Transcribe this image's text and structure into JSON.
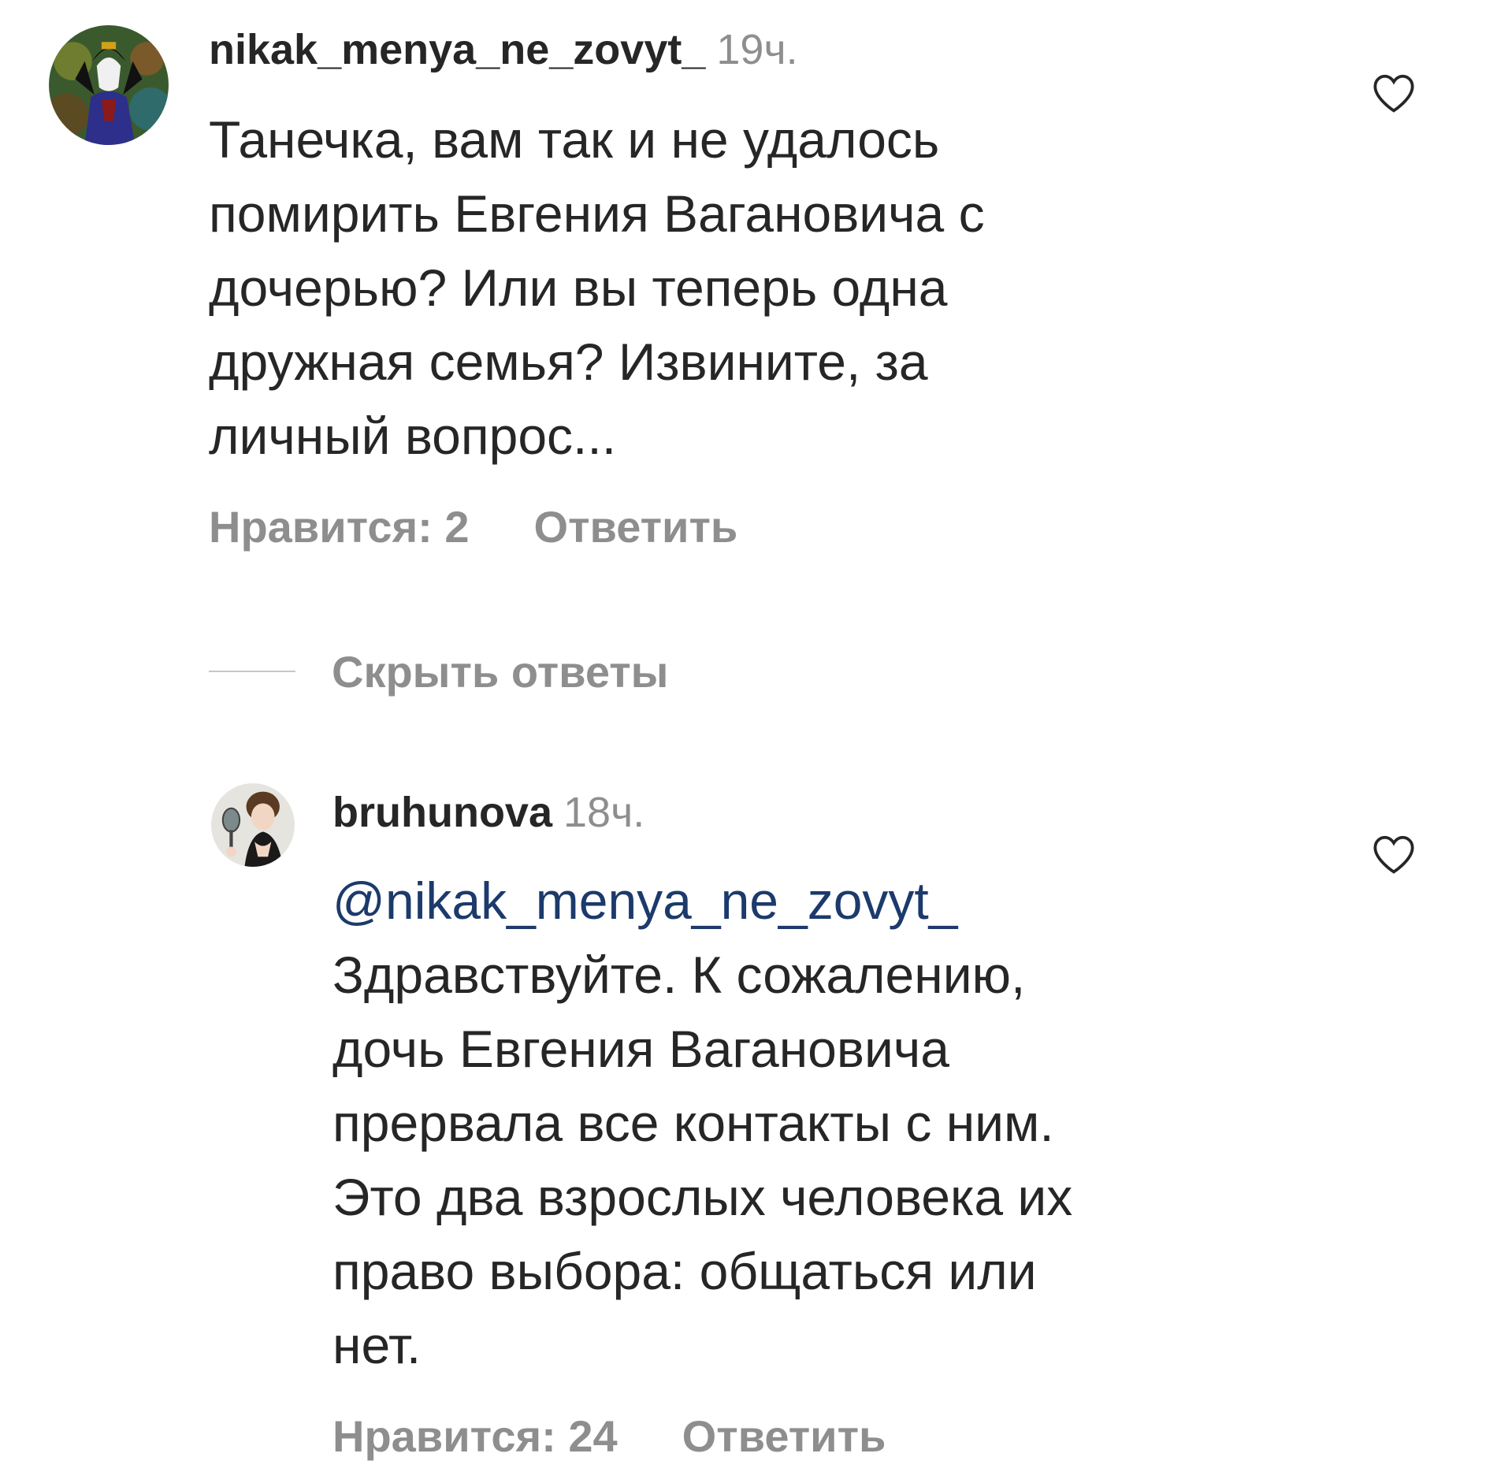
{
  "comments": [
    {
      "username": "nikak_menya_ne_zovyt_",
      "time": "19ч.",
      "text_lines": [
        "Танечка, вам так и не удалось",
        "помирить Евгения Вагановича с",
        "дочерью? Или вы теперь одна",
        "дружная семья? Извините, за",
        "личный вопрос..."
      ],
      "likes_label": "Нравится: 2",
      "reply_label": "Ответить",
      "avatar_icon": "evil-queen-avatar"
    },
    {
      "username": "bruhunova",
      "time": "18ч.",
      "mention": "@nikak_menya_ne_zovyt_",
      "text_lines": [
        "Здравствуйте. К сожалению,",
        "дочь Евгения Вагановича",
        "прервала все контакты с ним.",
        "Это два взрослых человека их",
        "право выбора: общаться или",
        "нет."
      ],
      "likes_label": "Нравится: 24",
      "reply_label": "Ответить",
      "avatar_icon": "woman-with-mirror-avatar"
    }
  ],
  "hide_replies_label": "Скрыть ответы",
  "colors": {
    "text": "#262626",
    "muted": "#8e8e8e",
    "mention": "#1c3a6b",
    "divider": "#c7c7c7"
  }
}
